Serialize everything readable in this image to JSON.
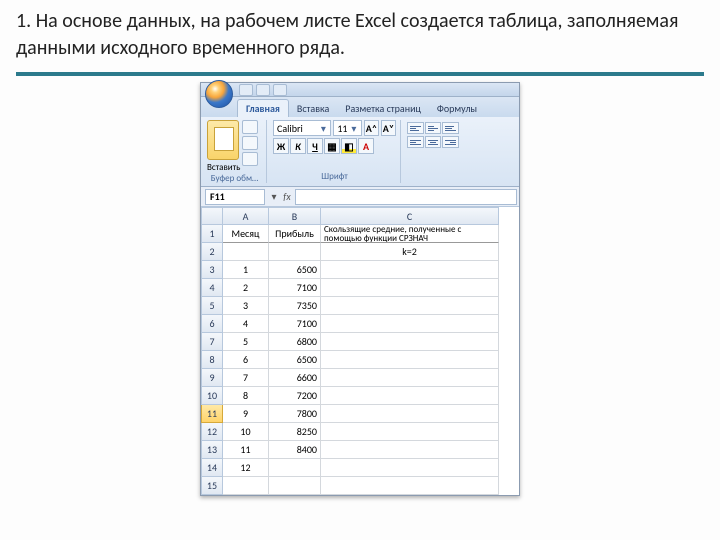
{
  "slide": {
    "heading": "1. На основе данных, на рабочем листе Excel создается таблица, заполняемая данными исходного временного ряда."
  },
  "qat": {
    "save": "save",
    "undo": "undo",
    "redo": "redo"
  },
  "tabs": {
    "home": "Главная",
    "insert": "Вставка",
    "layout": "Разметка страниц",
    "formulas": "Формулы"
  },
  "ribbon": {
    "clipboard": {
      "paste": "Вставить",
      "title": "Буфер обм…"
    },
    "font": {
      "name": "Calibri",
      "size": "11",
      "title": "Шрифт",
      "bold": "Ж",
      "italic": "К",
      "underline": "Ч",
      "grow": "A˄",
      "shrink": "A˅"
    }
  },
  "formula_bar": {
    "cell_ref": "F11",
    "fx": "fx"
  },
  "columns": {
    "A": "A",
    "B": "B",
    "C": "C"
  },
  "headers": {
    "month": "Месяц",
    "profit": "Прибыль",
    "ma": "Скользящие средние, полученные с помощью функции СРЗНАЧ",
    "k": "k=2"
  },
  "rows": [
    {
      "n": "1"
    },
    {
      "n": "2"
    },
    {
      "n": "3",
      "m": "1",
      "p": "6500"
    },
    {
      "n": "4",
      "m": "2",
      "p": "7100"
    },
    {
      "n": "5",
      "m": "3",
      "p": "7350"
    },
    {
      "n": "6",
      "m": "4",
      "p": "7100"
    },
    {
      "n": "7",
      "m": "5",
      "p": "6800"
    },
    {
      "n": "8",
      "m": "6",
      "p": "6500"
    },
    {
      "n": "9",
      "m": "7",
      "p": "6600"
    },
    {
      "n": "10",
      "m": "8",
      "p": "7200"
    },
    {
      "n": "11",
      "m": "9",
      "p": "7800"
    },
    {
      "n": "12",
      "m": "10",
      "p": "8250"
    },
    {
      "n": "13",
      "m": "11",
      "p": "8400"
    },
    {
      "n": "14",
      "m": "12",
      "p": ""
    },
    {
      "n": "15"
    }
  ]
}
